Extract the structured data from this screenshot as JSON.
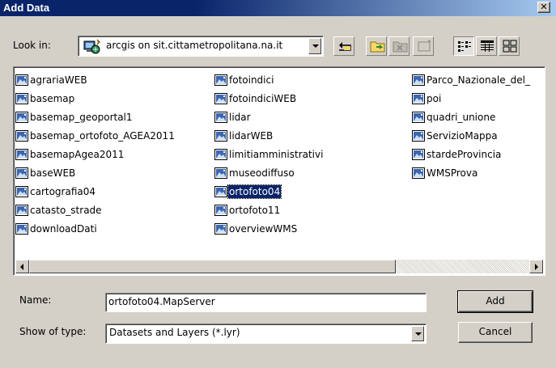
{
  "window": {
    "title": "Add Data",
    "close_glyph": "✕"
  },
  "lookin": {
    "label": "Look in:",
    "value": "arcgis on sit.cittametropolitana.na.it",
    "icon": "gis-server-icon"
  },
  "toolbar": {
    "buttons": [
      "up-one-level-icon",
      "connect-to-folder-icon",
      "disconnect-folder-icon",
      "new-folder-icon",
      "list-view-icon",
      "details-view-icon",
      "thumbnails-view-icon"
    ]
  },
  "files": {
    "item_icon": "map-service-icon",
    "selected": "ortofoto04",
    "columns": [
      [
        "agrariaWEB",
        "basemap",
        "basemap_geoportal1",
        "basemap_ortofoto_AGEA2011",
        "basemapAgea2011",
        "baseWEB",
        "cartografia04",
        "catasto_strade",
        "downloadDati"
      ],
      [
        "fotoindici",
        "fotoindiciWEB",
        "lidar",
        "lidarWEB",
        "limitiamministrativi",
        "museodiffuso",
        "ortofoto04",
        "ortofoto11",
        "overviewWMS"
      ],
      [
        "Parco_Nazionale_del_",
        "poi",
        "quadri_unione",
        "ServizioMappa",
        "stardeProvincia",
        "WMSProva"
      ]
    ]
  },
  "name": {
    "label": "Name:",
    "value": "ortofoto04.MapServer"
  },
  "type": {
    "label": "Show of type:",
    "value": "Datasets and Layers (*.lyr)"
  },
  "actions": {
    "add": "Add",
    "cancel": "Cancel"
  },
  "colors": {
    "title_bar": "#0a246a",
    "dialog_face": "#d4d0c8",
    "selection": "#0a246a"
  }
}
